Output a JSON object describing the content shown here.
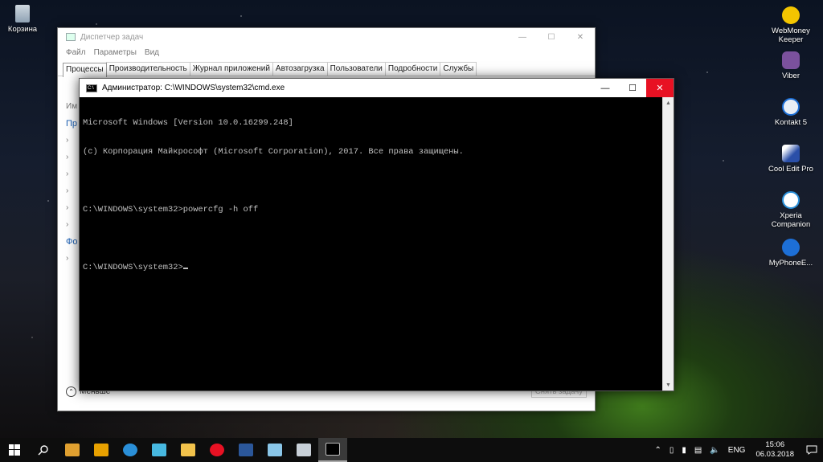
{
  "desktop": {
    "left_icons": [
      {
        "label": "Корзина",
        "icon": "recycle-bin-icon"
      }
    ],
    "right_icons": [
      {
        "label": "WebMoney Keeper",
        "icon": "webmoney-icon",
        "color": "#f3c500"
      },
      {
        "label": "Viber",
        "icon": "viber-icon",
        "color": "#7b519d"
      },
      {
        "label": "Kontakt 5",
        "icon": "kontakt-icon",
        "color": "#e8eef5"
      },
      {
        "label": "Cool Edit Pro",
        "icon": "cool-edit-icon",
        "color": "#2a4fa8"
      },
      {
        "label": "Xperia Companion",
        "icon": "xperia-icon",
        "color": "#2a8fd8"
      },
      {
        "label": "MyPhoneE...",
        "icon": "myphoneexplorer-icon",
        "color": "#1d6fd6"
      }
    ]
  },
  "task_manager": {
    "title": "Диспетчер задач",
    "menu": [
      "Файл",
      "Параметры",
      "Вид"
    ],
    "tabs": [
      "Процессы",
      "Производительность",
      "Журнал приложений",
      "Автозагрузка",
      "Пользователи",
      "Подробности",
      "Службы"
    ],
    "active_tab": "Процессы",
    "side_fragments": [
      "Им",
      "Пр",
      "Фо"
    ],
    "less_label": "Меньше",
    "end_task_label": "Снять задачу"
  },
  "cmd": {
    "title": "Администратор: C:\\WINDOWS\\system32\\cmd.exe",
    "lines": [
      "Microsoft Windows [Version 10.0.16299.248]",
      "(c) Корпорация Майкрософт (Microsoft Corporation), 2017. Все права защищены.",
      "",
      "C:\\WINDOWS\\system32>powercfg -h off",
      "",
      "C:\\WINDOWS\\system32>"
    ]
  },
  "taskbar": {
    "apps": [
      {
        "name": "start-button",
        "color": "#ffffff"
      },
      {
        "name": "search-button",
        "color": "#ffffff"
      },
      {
        "name": "paint-icon",
        "color": "#e0a030"
      },
      {
        "name": "winamp-icon",
        "color": "#e8a100"
      },
      {
        "name": "refresh-app-icon",
        "color": "#2a8fd8"
      },
      {
        "name": "photo-app-icon",
        "color": "#47b8e0"
      },
      {
        "name": "file-explorer-icon",
        "color": "#f2c24b"
      },
      {
        "name": "opera-icon",
        "color": "#e81123"
      },
      {
        "name": "word-icon",
        "color": "#2b579a"
      },
      {
        "name": "notepad-icon",
        "color": "#8ac6e8"
      },
      {
        "name": "network-app-icon",
        "color": "#c8d0d8"
      },
      {
        "name": "cmd-taskbar-icon",
        "color": "#222222"
      }
    ],
    "tray": {
      "language": "ENG",
      "time": "15:06",
      "date": "06.03.2018"
    }
  }
}
